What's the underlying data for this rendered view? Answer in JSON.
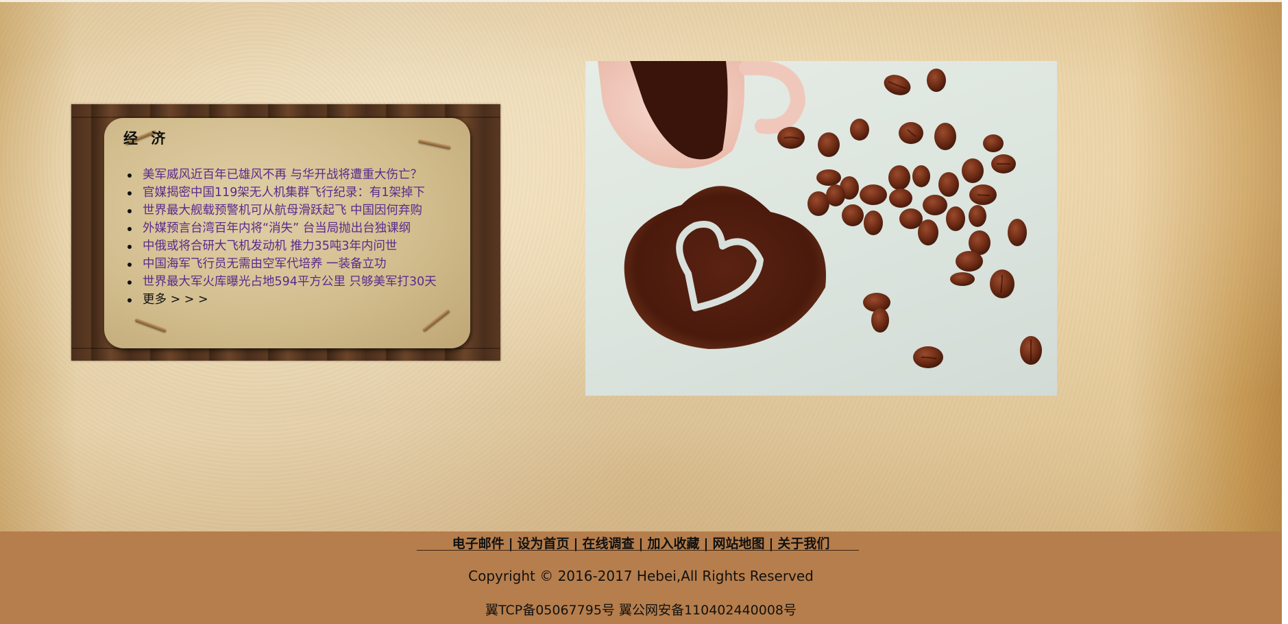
{
  "news": {
    "title": "经 济",
    "items": [
      "美军威风近百年已雄风不再 与华开战将遭重大伤亡？",
      "官媒揭密中国119架无人机集群飞行纪录：有1架掉下",
      "世界最大舰载预警机可从航母滑跃起飞 中国因何弃购",
      "外媒预言台湾百年内将“消失” 台当局抛出台独课纲",
      "中俄或将合研大飞机发动机 推力35吨3年内问世",
      "中国海军飞行员无需由空军代培养 一装备立功",
      "世界最大军火库曝光占地594平方公里 只够美军打30天"
    ],
    "more": "更多 > > >"
  },
  "footer": {
    "links": [
      "电子邮件",
      "设为首页",
      "在线调查",
      "加入收藏",
      "网站地图",
      "关于我们"
    ],
    "separator": "|",
    "copyright": "Copyright © 2016-2017 Hebei,All Rights Reserved",
    "icp": "翼TCP备05067795号 翼公网安备110402440008号"
  },
  "colors": {
    "footer_bg": "#b67e4c",
    "link_color": "#5a2a8c"
  }
}
